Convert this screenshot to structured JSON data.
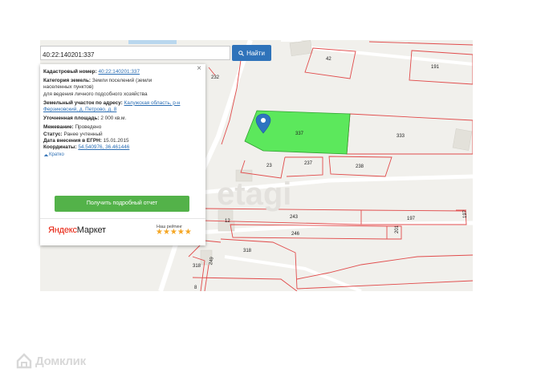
{
  "search": {
    "value": "40:22:140201:337",
    "button_label": "Найти"
  },
  "card": {
    "cadastral_label": "Кадастровый номер:",
    "cadastral_value": "40:22:140201:337",
    "category_label": "Категория земель:",
    "category_value_1": "Земли поселений (земли",
    "category_value_2": "населенных пунктов)",
    "category_value_3": "для ведения личного подсобного хозяйства",
    "address_label": "Земельный участок по адресу:",
    "address_value_1": "Калужская область, р-н",
    "address_value_2": "Ферзиковский, д. Петрово, д. 8",
    "area_label": "Уточненная площадь:",
    "area_value": "2 000 кв.м.",
    "survey_label": "Межевание:",
    "survey_value": "Проведено",
    "status_label": "Статус:",
    "status_value": "Ранее учтенный",
    "date_label": "Дата внесения в ЕГРН:",
    "date_value": "15.01.2015",
    "coords_label": "Координаты:",
    "coords_value": "54.540976, 36.461446",
    "brief_link": "Кратко",
    "report_button": "Получить подробный отчет",
    "close_glyph": "×"
  },
  "market": {
    "logo_part1": "Яндекс",
    "logo_part2": "Маркет",
    "rating_label": "Наш рейтинг",
    "stars": "★★★★★",
    "rating_value": 5
  },
  "map": {
    "plots": {
      "p42": "42",
      "p191": "191",
      "p232": "232",
      "p337": "337",
      "p333": "333",
      "p23": "23",
      "p237": "237",
      "p238": "238",
      "p243": "243",
      "p197a": "197",
      "p197b": "197",
      "p12": "12",
      "p246": "246",
      "p201": "201",
      "p318a": "318",
      "p318b": "318",
      "p249": "249",
      "p8": "8"
    },
    "watermark": "etagi",
    "colors": {
      "boundary": "#e14b4b",
      "selected": "#5ce85c",
      "marker": "#2e74c0"
    }
  },
  "footer_watermark": "Домклик"
}
